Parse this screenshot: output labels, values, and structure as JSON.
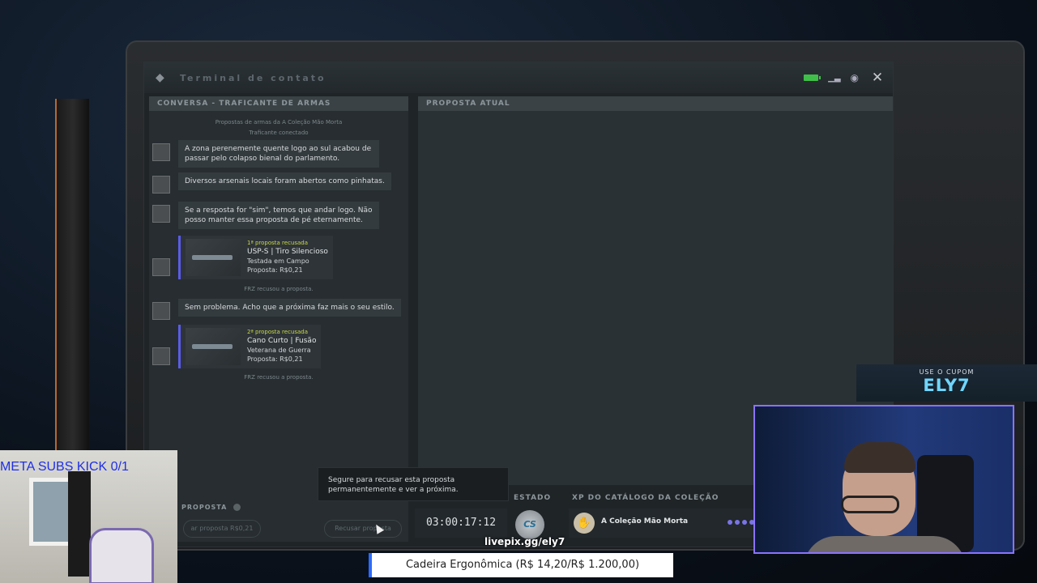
{
  "window": {
    "title": "Terminal de contato",
    "close_symbol": "✕"
  },
  "chat": {
    "header": "CONVERSA - TRAFICANTE DE ARMAS",
    "subtitle_line1": "Propostas de armas da A Coleção Mão Morta",
    "subtitle_line2": "Traficante conectado",
    "messages": [
      "A zona perenemente quente logo ao sul acabou de passar pelo colapso bienal do parlamento.",
      "Diversos arsenais locais foram abertos como pinhatas.",
      "Se a resposta for \"sim\", temos que andar logo. Não posso manter essa proposta de pé eternamente.",
      "Sem problema. Acho que a próxima faz mais o seu estilo."
    ],
    "offers": [
      {
        "status": "1ª proposta recusada",
        "name": "USP-S | Tiro Silencioso",
        "wear": "Testada em Campo",
        "price": "Proposta: R$0,21",
        "note": "FRZ recusou a proposta."
      },
      {
        "status": "2ª proposta recusada",
        "name": "Cano Curto | Fusão",
        "wear": "Veterana de Guerra",
        "price": "Proposta: R$0,21",
        "note": "FRZ recusou a proposta."
      }
    ]
  },
  "current_offer": {
    "header": "PROPOSTA ATUAL"
  },
  "actions": {
    "proposta_label": "PROPOSTA",
    "accept_label": "ar proposta R$0,21",
    "reject_label": "Recusar proposta",
    "tooltip": "Segure para recusar esta proposta permanentemente e ver a próxima."
  },
  "status": {
    "estado_label": "ESTADO",
    "xp_label": "XP DO CATÁLOGO DA COLEÇÃO",
    "timer": "03:00:17:12",
    "cs_logo": "CS",
    "collection_name": "A Coleção Mão Morta"
  },
  "overlay": {
    "coupon_top": "USE O CUPOM",
    "coupon_code": "ELY7",
    "meta_subs": "META SUBS KICK 0/1",
    "url": "livepix.gg/ely7",
    "donation": "Cadeira Ergonômica (R$ 14,20/R$ 1.200,00)"
  },
  "colors": {
    "accent_purple": "#5a5ce8",
    "status_yellow": "#c8d84a",
    "battery_green": "#3fbf4a",
    "coupon_cyan": "#6fd6ff"
  }
}
